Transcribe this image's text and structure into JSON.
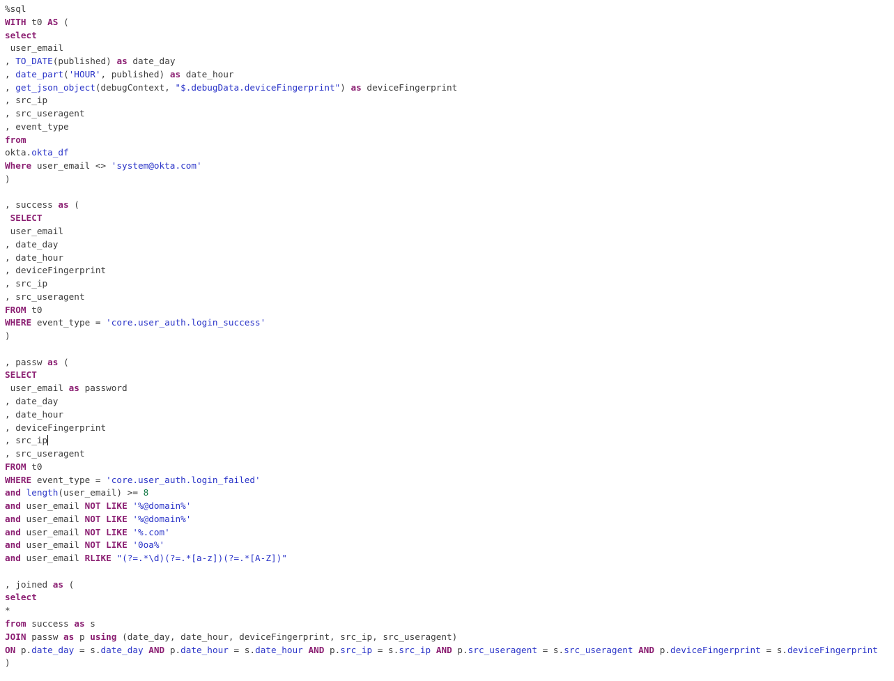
{
  "colors": {
    "keyword": "#8b1f72",
    "function_and_string": "#2a34c8",
    "number": "#117744",
    "plain": "#3d3d3d",
    "background": "#ffffff"
  },
  "editor": {
    "lines": [
      [
        [
          "pl",
          "%sql"
        ]
      ],
      [
        [
          "kw",
          "WITH"
        ],
        [
          "pl",
          " t0 "
        ],
        [
          "kw",
          "AS"
        ],
        [
          "pl",
          " ("
        ]
      ],
      [
        [
          "kw",
          "select"
        ]
      ],
      [
        [
          "pl",
          " user_email"
        ]
      ],
      [
        [
          "pl",
          ", "
        ],
        [
          "fn",
          "TO_DATE"
        ],
        [
          "pl",
          "(published) "
        ],
        [
          "kw",
          "as"
        ],
        [
          "pl",
          " date_day"
        ]
      ],
      [
        [
          "pl",
          ", "
        ],
        [
          "fn",
          "date_part"
        ],
        [
          "pl",
          "("
        ],
        [
          "str",
          "'HOUR'"
        ],
        [
          "pl",
          ", published) "
        ],
        [
          "kw",
          "as"
        ],
        [
          "pl",
          " date_hour"
        ]
      ],
      [
        [
          "pl",
          ", "
        ],
        [
          "fn",
          "get_json_object"
        ],
        [
          "pl",
          "(debugContext, "
        ],
        [
          "str",
          "\"$.debugData.deviceFingerprint\""
        ],
        [
          "pl",
          ") "
        ],
        [
          "kw",
          "as"
        ],
        [
          "pl",
          " deviceFingerprint"
        ]
      ],
      [
        [
          "pl",
          ", src_ip"
        ]
      ],
      [
        [
          "pl",
          ", src_useragent"
        ]
      ],
      [
        [
          "pl",
          ", event_type"
        ]
      ],
      [
        [
          "kw",
          "from"
        ]
      ],
      [
        [
          "pl",
          "okta."
        ],
        [
          "fn",
          "okta_df"
        ]
      ],
      [
        [
          "kw",
          "Where"
        ],
        [
          "pl",
          " user_email <> "
        ],
        [
          "str",
          "'system@okta.com'"
        ]
      ],
      [
        [
          "pl",
          ")"
        ]
      ],
      [],
      [
        [
          "pl",
          ", success "
        ],
        [
          "kw",
          "as"
        ],
        [
          "pl",
          " ("
        ]
      ],
      [
        [
          "pl",
          " "
        ],
        [
          "kw",
          "SELECT"
        ]
      ],
      [
        [
          "pl",
          " user_email"
        ]
      ],
      [
        [
          "pl",
          ", date_day"
        ]
      ],
      [
        [
          "pl",
          ", date_hour"
        ]
      ],
      [
        [
          "pl",
          ", deviceFingerprint"
        ]
      ],
      [
        [
          "pl",
          ", src_ip"
        ]
      ],
      [
        [
          "pl",
          ", src_useragent"
        ]
      ],
      [
        [
          "kw",
          "FROM"
        ],
        [
          "pl",
          " t0"
        ]
      ],
      [
        [
          "kw",
          "WHERE"
        ],
        [
          "pl",
          " event_type = "
        ],
        [
          "str",
          "'core.user_auth.login_success'"
        ]
      ],
      [
        [
          "pl",
          ")"
        ]
      ],
      [],
      [
        [
          "pl",
          ", passw "
        ],
        [
          "kw",
          "as"
        ],
        [
          "pl",
          " ("
        ]
      ],
      [
        [
          "kw",
          "SELECT"
        ]
      ],
      [
        [
          "pl",
          " user_email "
        ],
        [
          "kw",
          "as"
        ],
        [
          "pl",
          " password"
        ]
      ],
      [
        [
          "pl",
          ", date_day"
        ]
      ],
      [
        [
          "pl",
          ", date_hour"
        ]
      ],
      [
        [
          "pl",
          ", deviceFingerprint"
        ]
      ],
      [
        [
          "pl",
          ", src_ip"
        ],
        [
          "caret",
          ""
        ]
      ],
      [
        [
          "pl",
          ", src_useragent"
        ]
      ],
      [
        [
          "kw",
          "FROM"
        ],
        [
          "pl",
          " t0"
        ]
      ],
      [
        [
          "kw",
          "WHERE"
        ],
        [
          "pl",
          " event_type = "
        ],
        [
          "str",
          "'core.user_auth.login_failed'"
        ]
      ],
      [
        [
          "kw",
          "and"
        ],
        [
          "pl",
          " "
        ],
        [
          "fn",
          "length"
        ],
        [
          "pl",
          "(user_email) >= "
        ],
        [
          "num",
          "8"
        ]
      ],
      [
        [
          "kw",
          "and"
        ],
        [
          "pl",
          " user_email "
        ],
        [
          "kw",
          "NOT LIKE"
        ],
        [
          "pl",
          " "
        ],
        [
          "str",
          "'%@domain%'"
        ]
      ],
      [
        [
          "kw",
          "and"
        ],
        [
          "pl",
          " user_email "
        ],
        [
          "kw",
          "NOT LIKE"
        ],
        [
          "pl",
          " "
        ],
        [
          "str",
          "'%@domain%'"
        ]
      ],
      [
        [
          "kw",
          "and"
        ],
        [
          "pl",
          " user_email "
        ],
        [
          "kw",
          "NOT LIKE"
        ],
        [
          "pl",
          " "
        ],
        [
          "str",
          "'%.com'"
        ]
      ],
      [
        [
          "kw",
          "and"
        ],
        [
          "pl",
          " user_email "
        ],
        [
          "kw",
          "NOT LIKE"
        ],
        [
          "pl",
          " "
        ],
        [
          "str",
          "'0oa%'"
        ]
      ],
      [
        [
          "kw",
          "and"
        ],
        [
          "pl",
          " user_email "
        ],
        [
          "kw",
          "RLIKE"
        ],
        [
          "pl",
          " "
        ],
        [
          "str",
          "\"(?=.*\\d)(?=.*[a-z])(?=.*[A-Z])\""
        ]
      ],
      [],
      [
        [
          "pl",
          ", joined "
        ],
        [
          "kw",
          "as"
        ],
        [
          "pl",
          " ("
        ]
      ],
      [
        [
          "kw",
          "select"
        ]
      ],
      [
        [
          "pl",
          "*"
        ]
      ],
      [
        [
          "kw",
          "from"
        ],
        [
          "pl",
          " success "
        ],
        [
          "kw",
          "as"
        ],
        [
          "pl",
          " s"
        ]
      ],
      [
        [
          "kw",
          "JOIN"
        ],
        [
          "pl",
          " passw "
        ],
        [
          "kw",
          "as"
        ],
        [
          "pl",
          " p "
        ],
        [
          "kw",
          "using"
        ],
        [
          "pl",
          " (date_day, date_hour, deviceFingerprint, src_ip, src_useragent)"
        ]
      ],
      [
        [
          "kw",
          "ON"
        ],
        [
          "pl",
          " p."
        ],
        [
          "fn",
          "date_day"
        ],
        [
          "pl",
          " = s."
        ],
        [
          "fn",
          "date_day"
        ],
        [
          "pl",
          " "
        ],
        [
          "kw",
          "AND"
        ],
        [
          "pl",
          " p."
        ],
        [
          "fn",
          "date_hour"
        ],
        [
          "pl",
          " = s."
        ],
        [
          "fn",
          "date_hour"
        ],
        [
          "pl",
          " "
        ],
        [
          "kw",
          "AND"
        ],
        [
          "pl",
          " p."
        ],
        [
          "fn",
          "src_ip"
        ],
        [
          "pl",
          " = s."
        ],
        [
          "fn",
          "src_ip"
        ],
        [
          "pl",
          " "
        ],
        [
          "kw",
          "AND"
        ],
        [
          "pl",
          " p."
        ],
        [
          "fn",
          "src_useragent"
        ],
        [
          "pl",
          " = s."
        ],
        [
          "fn",
          "src_useragent"
        ],
        [
          "pl",
          " "
        ],
        [
          "kw",
          "AND"
        ],
        [
          "pl",
          " p."
        ],
        [
          "fn",
          "deviceFingerprint"
        ],
        [
          "pl",
          " = s."
        ],
        [
          "fn",
          "deviceFingerprint"
        ]
      ],
      [
        [
          "pl",
          ")"
        ]
      ]
    ]
  }
}
